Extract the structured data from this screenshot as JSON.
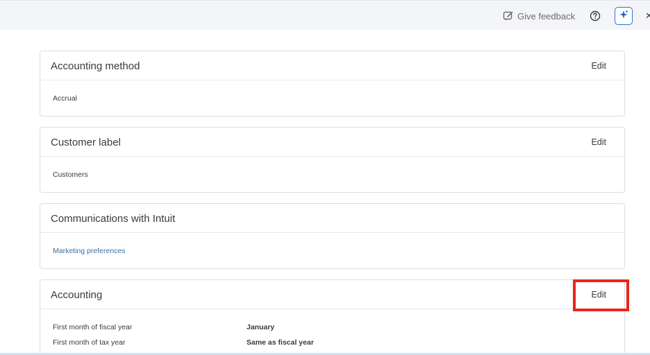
{
  "topbar": {
    "feedback_label": "Give feedback",
    "icons": [
      "feedback-icon",
      "help-icon",
      "assistant-icon",
      "close-icon"
    ],
    "accent_color": "#2f6fd6"
  },
  "cards": {
    "accounting_method": {
      "title": "Accounting method",
      "edit_label": "Edit",
      "value": "Accrual"
    },
    "customer_label": {
      "title": "Customer label",
      "edit_label": "Edit",
      "value": "Customers"
    },
    "communications": {
      "title": "Communications with Intuit",
      "link": "Marketing preferences"
    },
    "accounting": {
      "title": "Accounting",
      "edit_label": "Edit",
      "rows": [
        {
          "label": "First month of fiscal year",
          "value": "January"
        },
        {
          "label": "First month of tax year",
          "value": "Same as fiscal year"
        }
      ]
    }
  },
  "highlight_color": "#e8261c"
}
